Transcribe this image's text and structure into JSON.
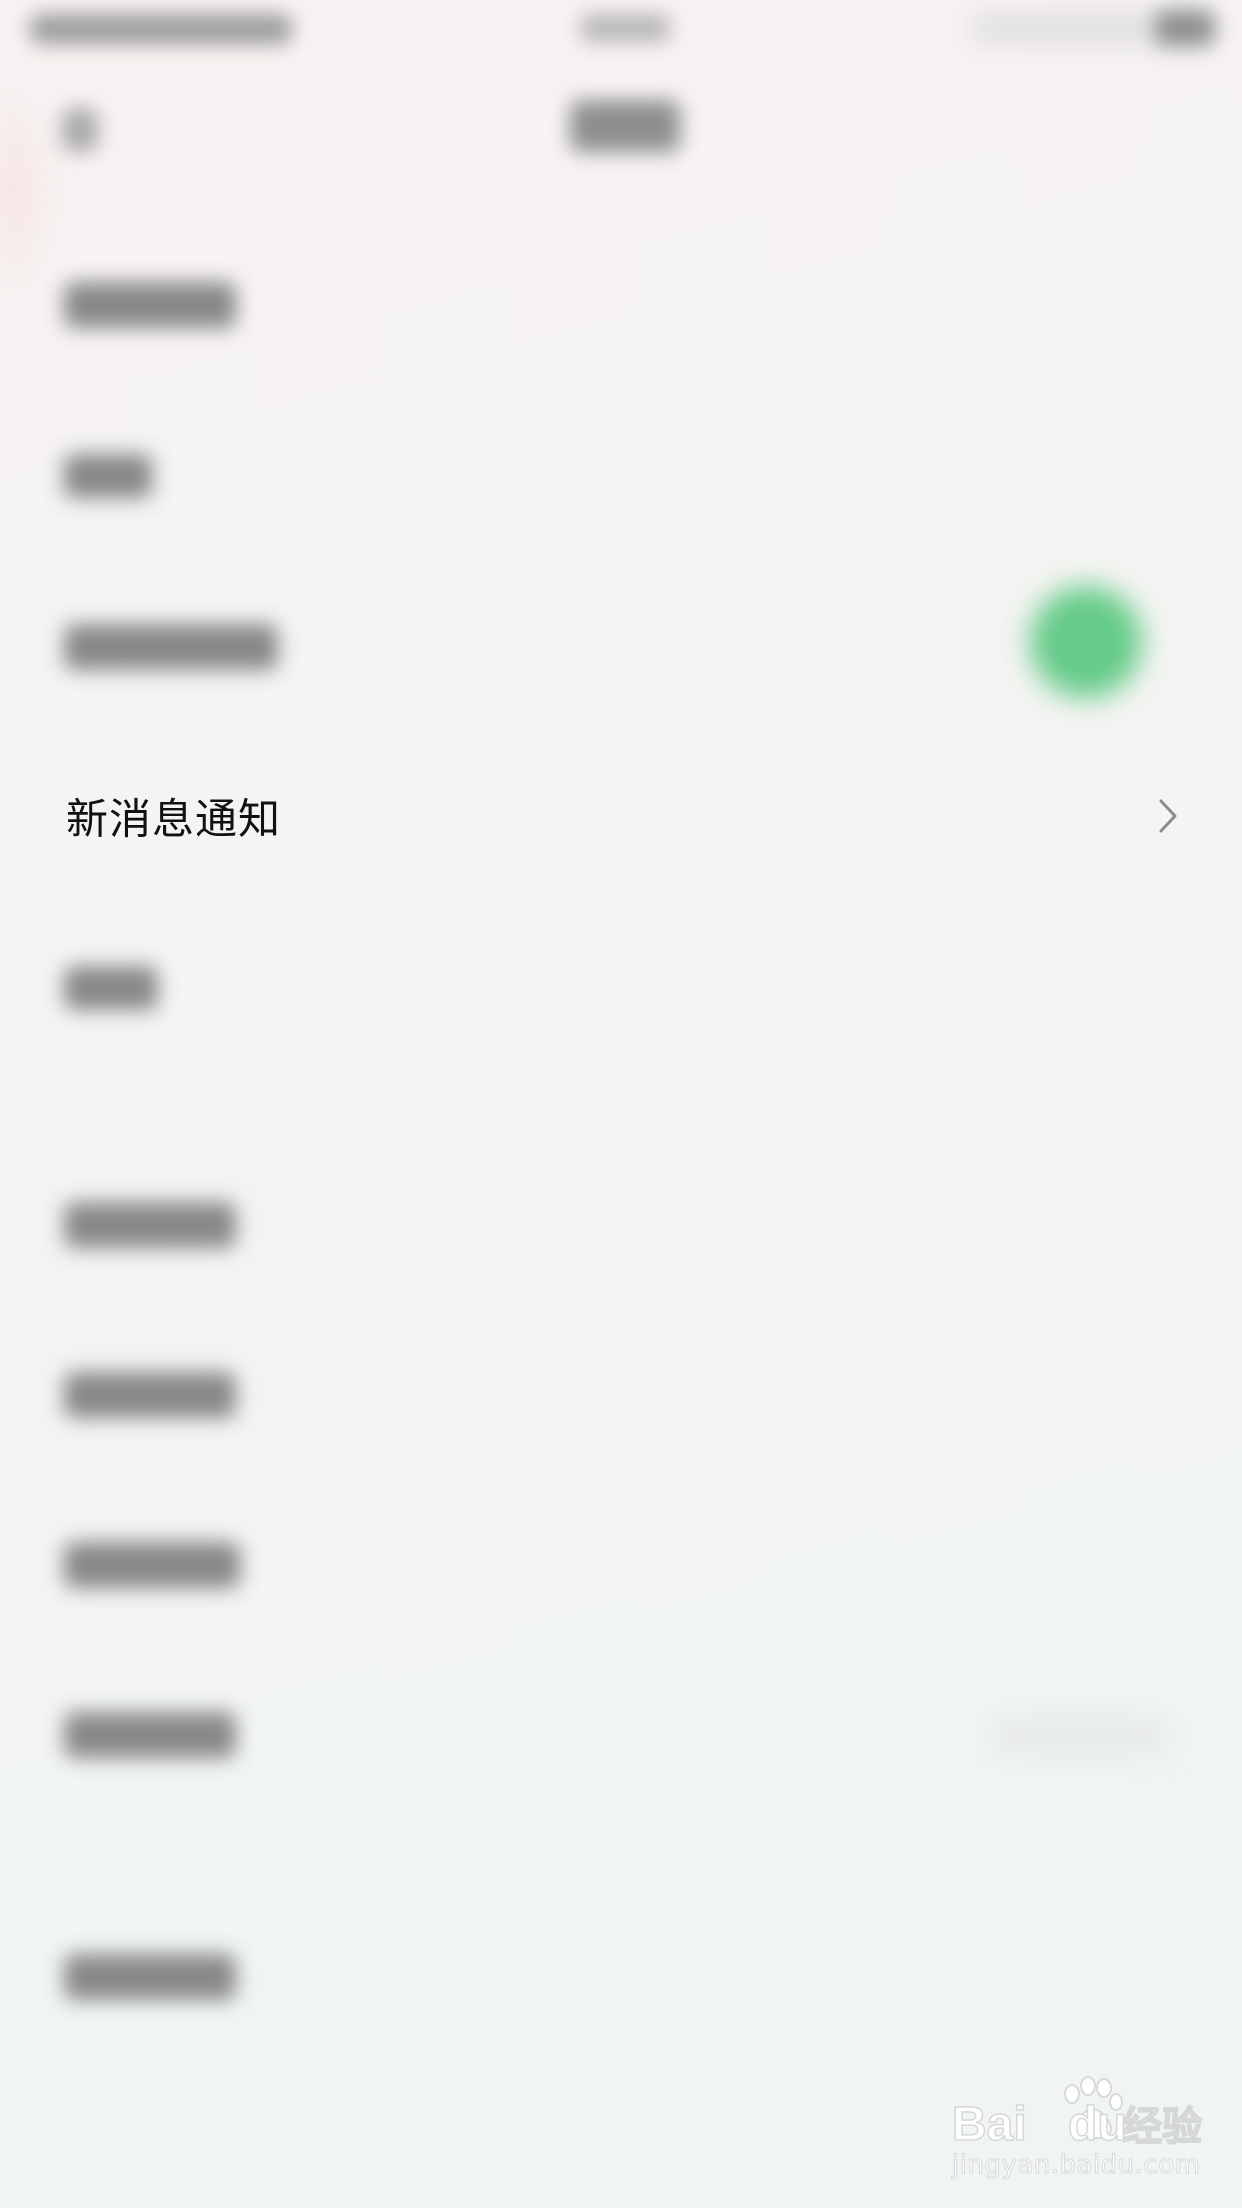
{
  "settings": {
    "notification_row": {
      "label": "新消息通知",
      "chevron_icon": "chevron-right-icon"
    },
    "toggle_color": "#4cc476"
  },
  "watermark": {
    "logo_text": "Baidu经验",
    "url": "jingyan.baidu.com"
  }
}
